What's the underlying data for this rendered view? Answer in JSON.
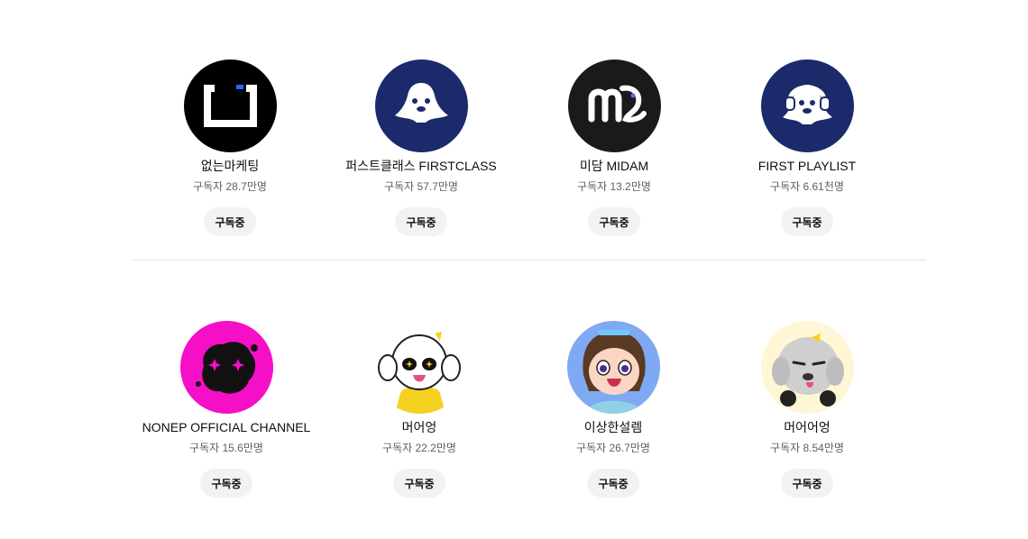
{
  "channels": [
    {
      "name": "없는마케팅",
      "subscribers": "구독자 28.7만명",
      "button_label": "구독중",
      "avatar_icon": "bracket-logo-icon",
      "avatar_bg": "#000000"
    },
    {
      "name": "퍼스트클래스 FIRSTCLASS",
      "subscribers": "구독자 57.7만명",
      "button_label": "구독중",
      "avatar_icon": "dog-mascot-icon",
      "avatar_bg": "#1b2a6b"
    },
    {
      "name": "미담 MIDAM",
      "subscribers": "구독자 13.2만명",
      "button_label": "구독중",
      "avatar_icon": "m-letter-logo-icon",
      "avatar_bg": "#1a1a1a"
    },
    {
      "name": "FIRST PLAYLIST",
      "subscribers": "구독자 6.61천명",
      "button_label": "구독중",
      "avatar_icon": "headphone-dog-icon",
      "avatar_bg": "#1b2a6b"
    },
    {
      "name": "NONEP OFFICIAL CHANNEL",
      "subscribers": "구독자 15.6만명",
      "button_label": "구독중",
      "avatar_icon": "black-blob-sparkle-icon",
      "avatar_bg": "#f50fc6"
    },
    {
      "name": "머어엉",
      "subscribers": "구독자 22.2만명",
      "button_label": "구독중",
      "avatar_icon": "white-dog-character-icon",
      "avatar_bg": "#ffffff"
    },
    {
      "name": "이상한설렘",
      "subscribers": "구독자 26.7만명",
      "button_label": "구독중",
      "avatar_icon": "anime-girl-icon",
      "avatar_bg": "#7fa9f2"
    },
    {
      "name": "머어어엉",
      "subscribers": "구독자 8.54만명",
      "button_label": "구독중",
      "avatar_icon": "gray-dog-headphones-icon",
      "avatar_bg": "#fff6d6"
    }
  ]
}
